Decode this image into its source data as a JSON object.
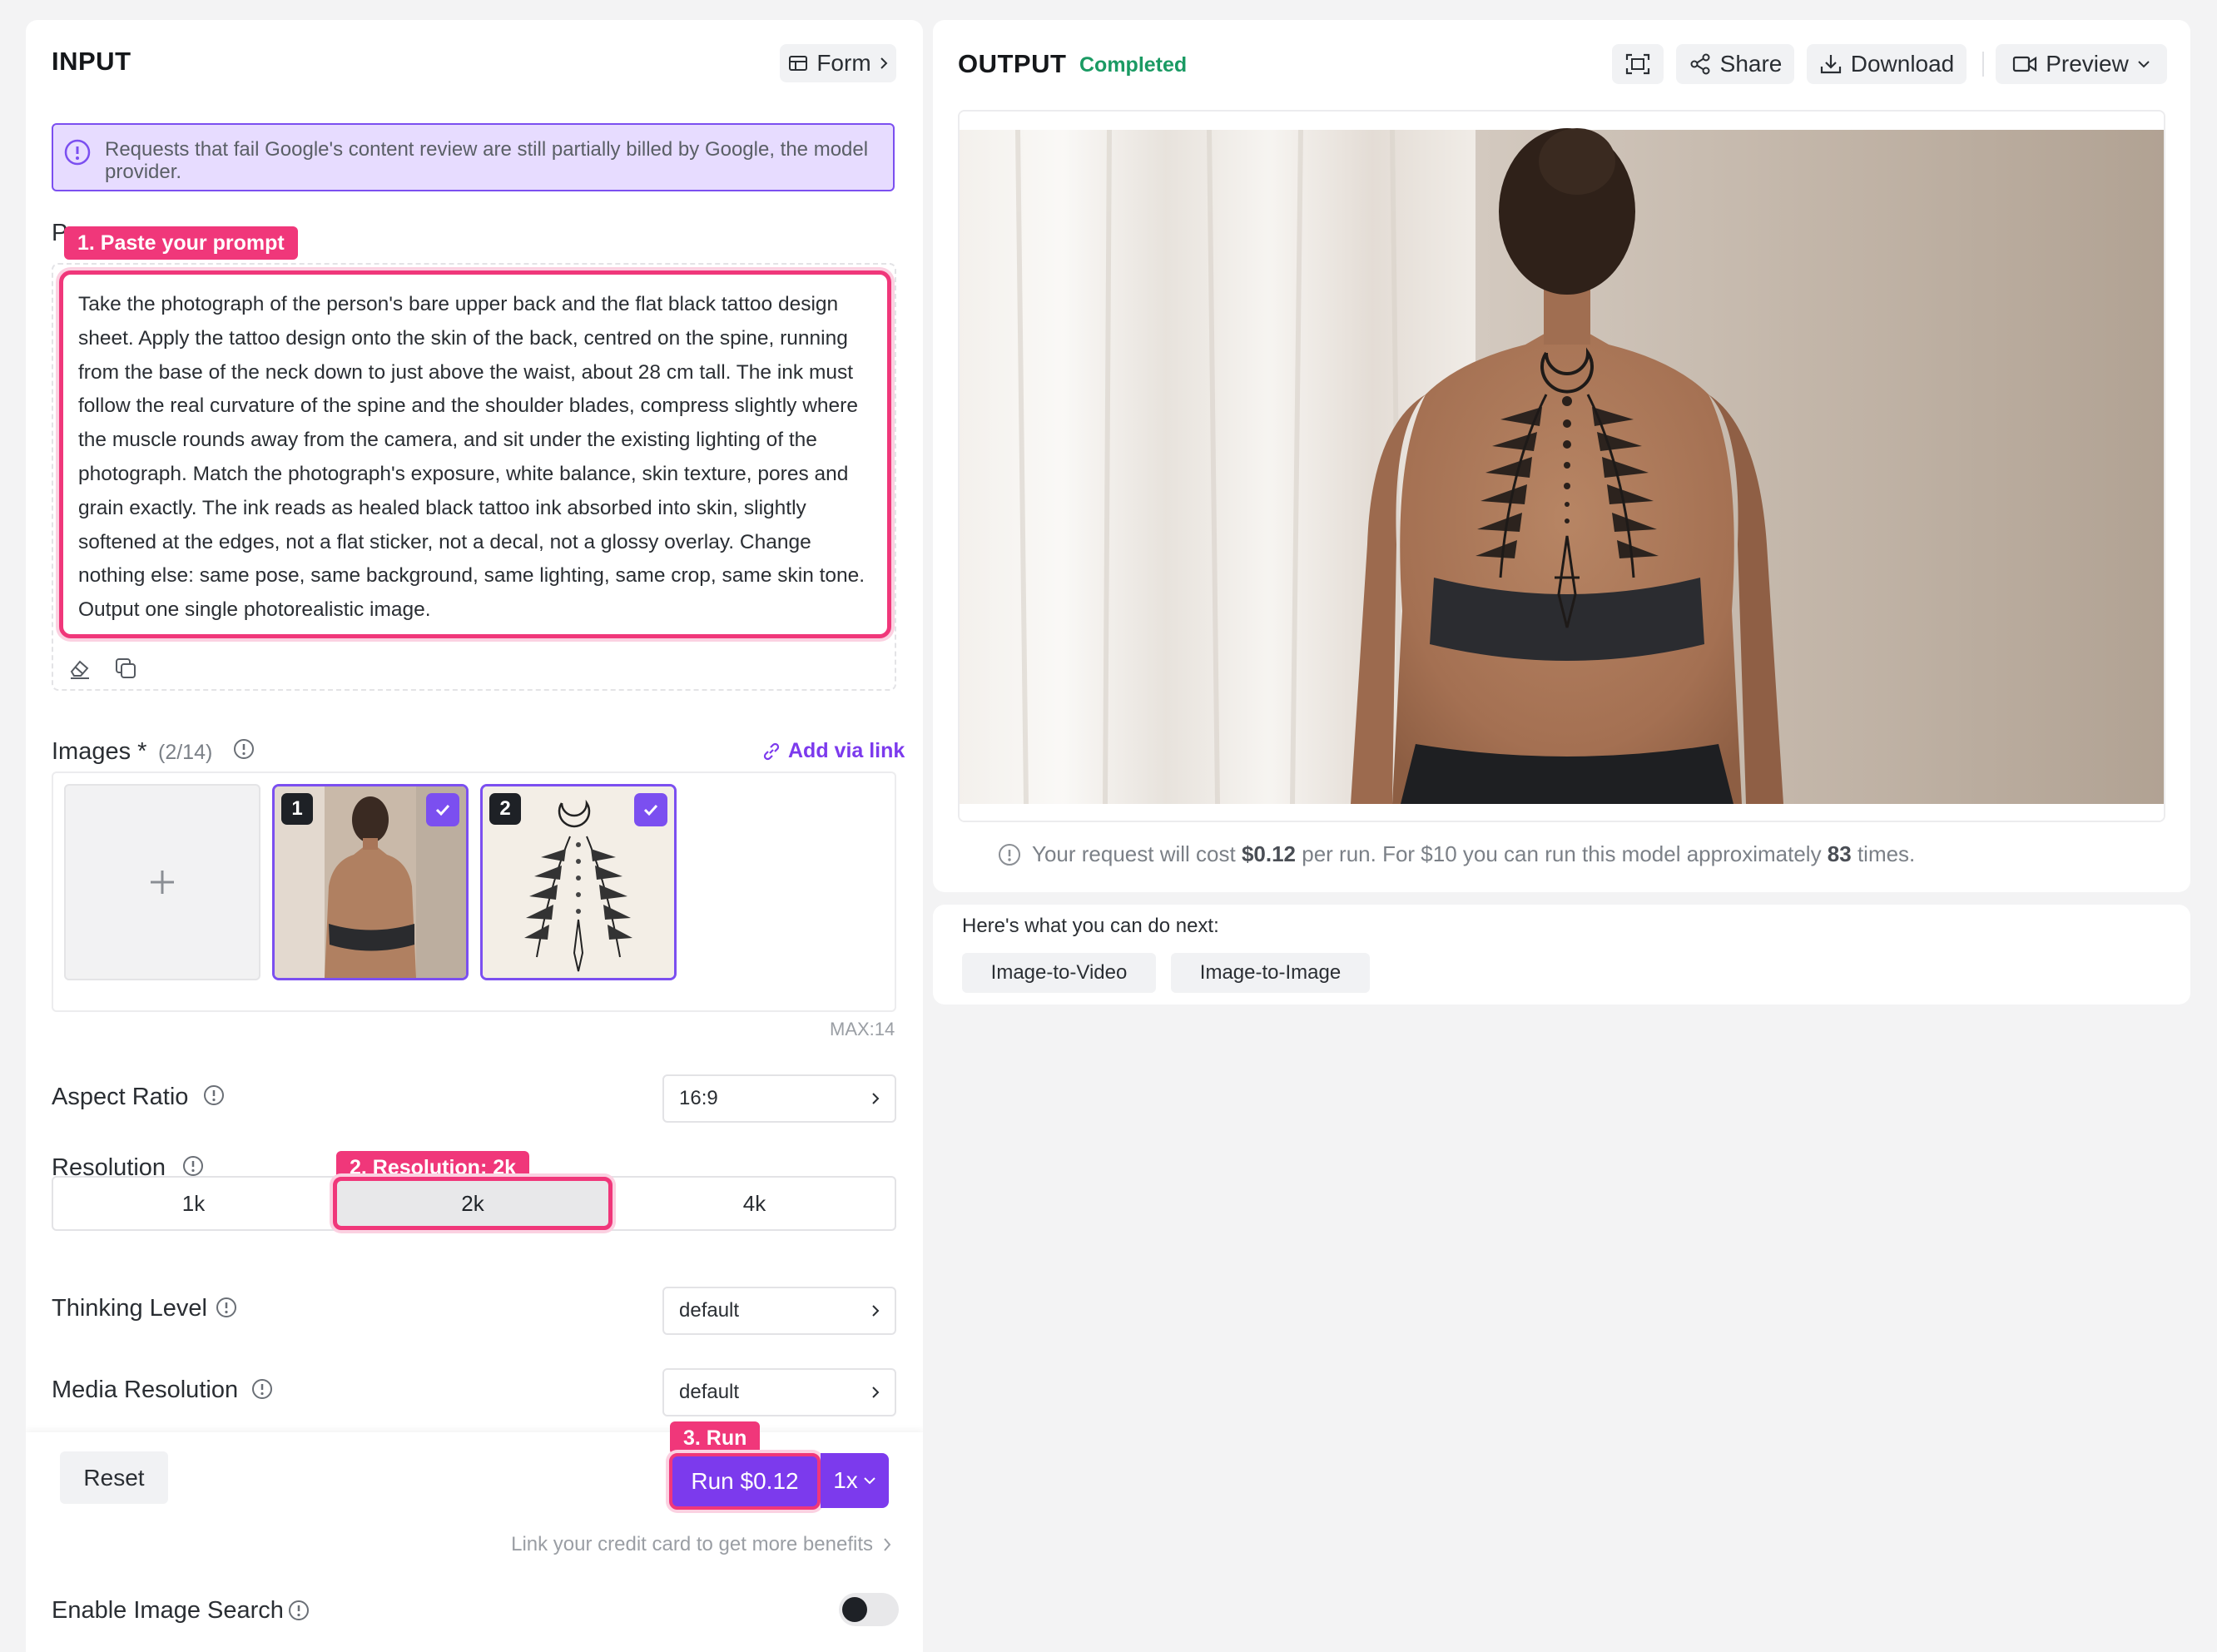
{
  "input": {
    "title": "INPUT",
    "form_button": "Form",
    "notice": "Requests that fail Google's content review are still partially billed by Google, the model provider.",
    "prompt_label_initial": "P",
    "prompt_text": "Take the photograph of the person's bare upper back and the flat black tattoo design sheet. Apply the tattoo design onto the skin of the back, centred on the spine, running from the base of the neck down to just above the waist, about 28 cm tall. The ink must follow the real curvature of the spine and the shoulder blades, compress slightly where the muscle rounds away from the camera, and sit under the existing lighting of the photograph. Match the photograph's exposure, white balance, skin texture, pores and grain exactly. The ink reads as healed black tattoo ink absorbed into skin, slightly softened at the edges, not a flat sticker, not a decal, not a glossy overlay. Change nothing else: same pose, same background, same lighting, same crop, same skin tone. Output one single photorealistic image.",
    "images": {
      "label": "Images *",
      "count": "(2/14)",
      "add_via_link": "Add via link",
      "max": "MAX:14",
      "thumbs": [
        {
          "number": "1"
        },
        {
          "number": "2"
        }
      ]
    },
    "aspect_ratio": {
      "label": "Aspect Ratio",
      "value": "16:9"
    },
    "resolution": {
      "label": "Resolution",
      "options": [
        "1k",
        "2k",
        "4k"
      ],
      "selected": "2k"
    },
    "thinking_level": {
      "label": "Thinking Level",
      "value": "default"
    },
    "media_resolution": {
      "label": "Media Resolution",
      "value": "default"
    },
    "reset": "Reset",
    "run": "Run $0.12",
    "quantity": "1x",
    "credit_link": "Link your credit card to get more benefits",
    "image_search": {
      "label": "Enable Image Search",
      "enabled": true
    }
  },
  "callouts": {
    "step1": "1. Paste your prompt",
    "step2": "2. Resolution: 2k",
    "step3": "3. Run"
  },
  "output": {
    "title": "OUTPUT",
    "status": "Completed",
    "share": "Share",
    "download": "Download",
    "preview": "Preview",
    "cost_prefix": "Your request will cost ",
    "cost_amount": "$0.12",
    "cost_mid": " per run. For $10 you can run this model approximately ",
    "cost_times": "83",
    "cost_suffix": " times."
  },
  "next": {
    "title": "Here's what you can do next:",
    "options": [
      "Image-to-Video",
      "Image-to-Image"
    ]
  },
  "colors": {
    "accent": "#7c3aed",
    "callout": "#f0377a",
    "status_green": "#1a9a63"
  }
}
